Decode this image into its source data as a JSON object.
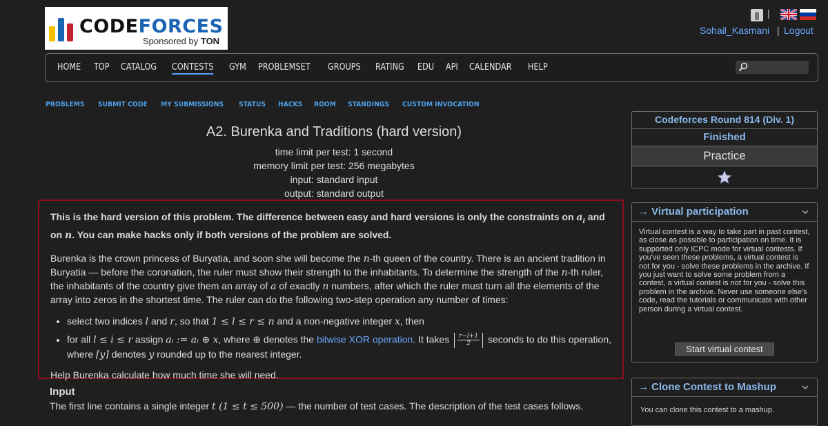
{
  "brand": {
    "word1": "CODE",
    "word2": "FORCES",
    "sponsored_by": "Sponsored by",
    "sponsor": "TON"
  },
  "user": {
    "username": "Sohail_Kasmani",
    "logout": "Logout",
    "separator": "|"
  },
  "main_menu": [
    "HOME",
    "TOP",
    "CATALOG",
    "CONTESTS",
    "GYM",
    "PROBLEMSET",
    "GROUPS",
    "RATING",
    "EDU",
    "API",
    "CALENDAR",
    "HELP"
  ],
  "active_menu": "CONTESTS",
  "sub_menu": [
    "PROBLEMS",
    "SUBMIT CODE",
    "MY SUBMISSIONS",
    "STATUS",
    "HACKS",
    "ROOM",
    "STANDINGS",
    "CUSTOM INVOCATION"
  ],
  "problem": {
    "title": "A2. Burenka and Traditions (hard version)",
    "time_limit": "time limit per test: 1 second",
    "memory_limit": "memory limit per test: 256 megabytes",
    "input": "input: standard input",
    "output": "output: standard output",
    "hard_note_1": "This is the hard version of this problem. The difference between easy and hard versions is only the constraints on ",
    "hard_note_ai": "a",
    "hard_note_i": "i",
    "hard_note_2": " and on ",
    "hard_note_n": "n",
    "hard_note_3": ". You can make hacks only if both versions of the problem are solved.",
    "legend_1": "Burenka is the crown princess of Buryatia, and soon she will become the ",
    "legend_n1": "n",
    "legend_2": "-th queen of the country. There is an ancient tradition in Buryatia — before the coronation, the ruler must show their strength to the inhabitants. To determine the strength of the ",
    "legend_n2": "n",
    "legend_3": "-th ruler, the inhabitants of the country give them an array of ",
    "legend_a": "a",
    "legend_4": " of exactly ",
    "legend_n3": "n",
    "legend_5": " numbers, after which the ruler must turn all the elements of the array into zeros in the shortest time. The ruler can do the following two-step operation any number of times:",
    "bullet1_1": "select two indices ",
    "bullet1_l": "l",
    "bullet1_and": " and ",
    "bullet1_r": "r",
    "bullet1_2": ", so that ",
    "bullet1_ineq": "1 ≤ l ≤ r ≤ n",
    "bullet1_3": " and a non-negative integer ",
    "bullet1_x": "x",
    "bullet1_4": ", then",
    "bullet2_1": "for all ",
    "bullet2_ineq": "l ≤ i ≤ r",
    "bullet2_2": " assign ",
    "bullet2_assign": "aᵢ := aᵢ ⊕ x",
    "bullet2_3": ", where ⊕ denotes the ",
    "bullet2_link": "bitwise XOR operation",
    "bullet2_4": ". It takes ",
    "bullet2_num": "r−l+1",
    "bullet2_den": "2",
    "bullet2_5": " seconds to do this operation, where ",
    "bullet2_ceil": "⌈y⌉",
    "bullet2_6": " denotes ",
    "bullet2_y": "y",
    "bullet2_7": " rounded up to the nearest integer.",
    "help": "Help Burenka calculate how much time she will need.",
    "input_heading": "Input",
    "input_text_1": "The first line contains a single integer ",
    "input_t": "t (1 ≤ t ≤ 500)",
    "input_text_2": " — the number of test cases. The description of the test cases follows."
  },
  "sidebar": {
    "round": "Codeforces Round 814 (Div. 1)",
    "status": "Finished",
    "mode": "Practice",
    "virtual_title": "→ Virtual participation",
    "virtual_text": "Virtual contest is a way to take part in past contest, as close as possible to participation on time. It is supported only ICPC mode for virtual contests. If you've seen these problems, a virtual contest is not for you - solve these problems in the archive. If you just want to solve some problem from a contest, a virtual contest is not for you - solve this problem in the archive. Never use someone else's code, read the tutorials or communicate with other person during a virtual contest.",
    "virtual_button": "Start virtual contest",
    "mashup_title": "→ Clone Contest to Mashup",
    "mashup_text": "You can clone this contest to a mashup."
  },
  "colors": {
    "background": "#1f1f1f",
    "link": "#6aa8ff",
    "highlight_border": "#8b0d1e",
    "sidebar_title": "#8ab7ea"
  }
}
